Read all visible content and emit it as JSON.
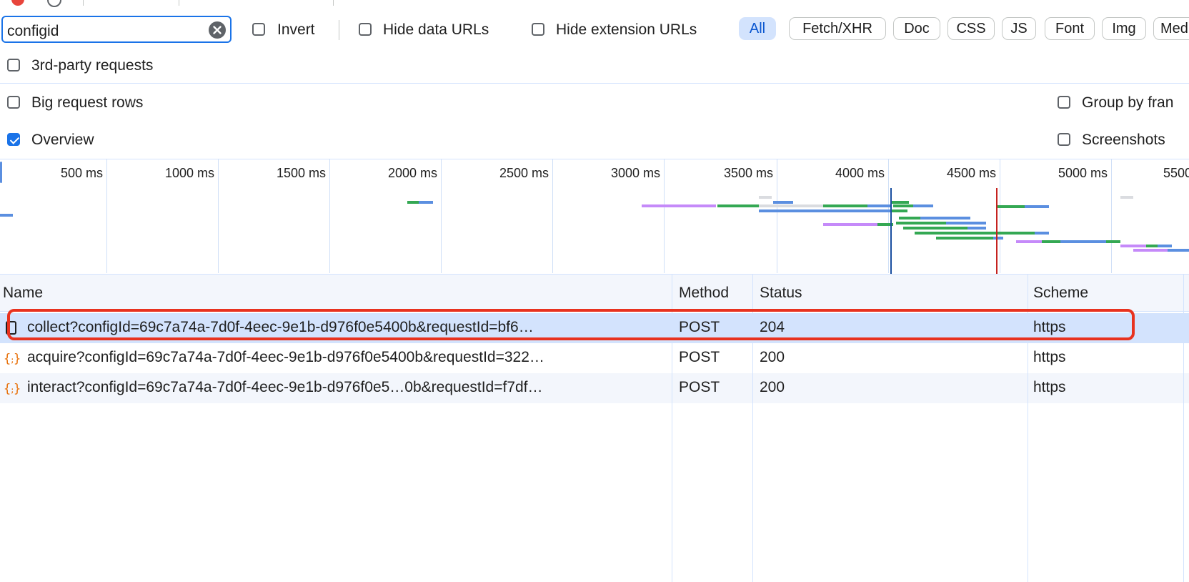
{
  "filter": {
    "value": "configid",
    "clear_icon": "close-circle-icon",
    "invert_label": "Invert",
    "hide_data_urls_label": "Hide data URLs",
    "hide_extension_urls_label": "Hide extension URLs",
    "type_chips": [
      "All",
      "Fetch/XHR",
      "Doc",
      "CSS",
      "JS",
      "Font",
      "Img",
      "Med"
    ]
  },
  "options": {
    "third_party_label": "3rd-party requests",
    "big_rows_label": "Big request rows",
    "group_by_frame_label": "Group by fran",
    "overview_label": "Overview",
    "overview_checked": true,
    "screenshots_label": "Screenshots"
  },
  "overview": {
    "ticks": [
      "500 ms",
      "1000 ms",
      "1500 ms",
      "2000 ms",
      "2500 ms",
      "3000 ms",
      "3500 ms",
      "4000 ms",
      "4500 ms",
      "5000 ms",
      "5500"
    ],
    "colors": {
      "xhr": "#5b8fe0",
      "script": "#34a853",
      "doc": "#c58af9",
      "other": "#dadce0",
      "dom_loaded": "#1a4fa0",
      "load": "#c5221f"
    }
  },
  "table": {
    "columns": [
      "Name",
      "Method",
      "Status",
      "Scheme"
    ],
    "rows": [
      {
        "name": "collect?configId=69c7a74a-7d0f-4eec-9e1b-d976f0e5400b&requestId=bf6…",
        "method": "POST",
        "status": "204",
        "scheme": "https",
        "icon": "document-icon",
        "selected": true
      },
      {
        "name": "acquire?configId=69c7a74a-7d0f-4eec-9e1b-d976f0e5400b&requestId=322…",
        "method": "POST",
        "status": "200",
        "scheme": "https",
        "icon": "fetch-braces-icon",
        "selected": false
      },
      {
        "name": "interact?configId=69c7a74a-7d0f-4eec-9e1b-d976f0e5…0b&requestId=f7df…",
        "method": "POST",
        "status": "200",
        "scheme": "https",
        "icon": "fetch-braces-icon",
        "selected": false
      }
    ]
  },
  "annotation": {
    "highlight_color": "#e8321f"
  }
}
